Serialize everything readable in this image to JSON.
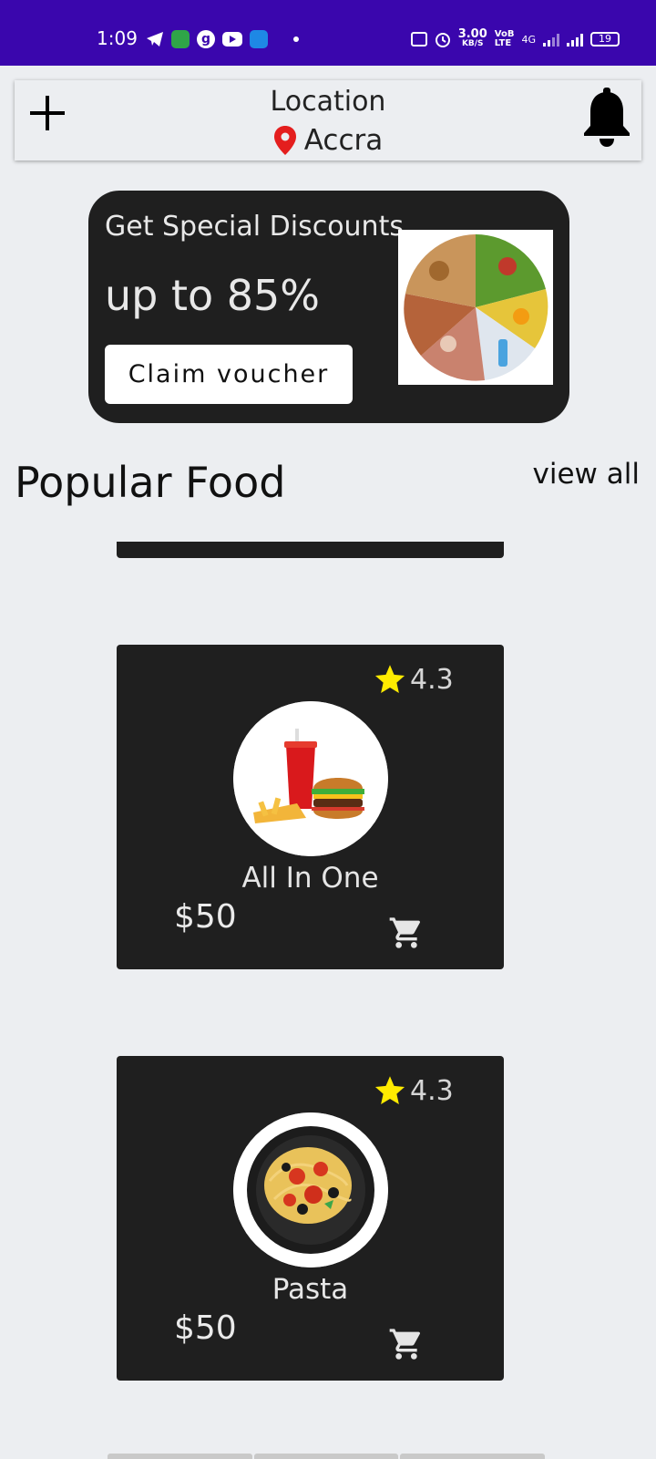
{
  "status_bar": {
    "time": "1:09",
    "speed_value": "3.00",
    "speed_unit": "KB/S",
    "network": "4G",
    "battery": "19"
  },
  "header": {
    "title": "Location",
    "city": "Accra"
  },
  "promo": {
    "title": "Get Special Discounts",
    "discount": "up to 85%",
    "button_label": "Claim voucher"
  },
  "section": {
    "title": "Popular Food",
    "view_all": "view all"
  },
  "foods": [
    {
      "name": "All In One",
      "price": "$50",
      "rating": "4.3"
    },
    {
      "name": "Pasta",
      "price": "$50",
      "rating": "4.3"
    }
  ],
  "colors": {
    "status_bar": "#3a06ad",
    "card": "#1f1f1f",
    "star": "#ffeb00",
    "pin": "#e41e1e",
    "background": "#eceef1"
  }
}
